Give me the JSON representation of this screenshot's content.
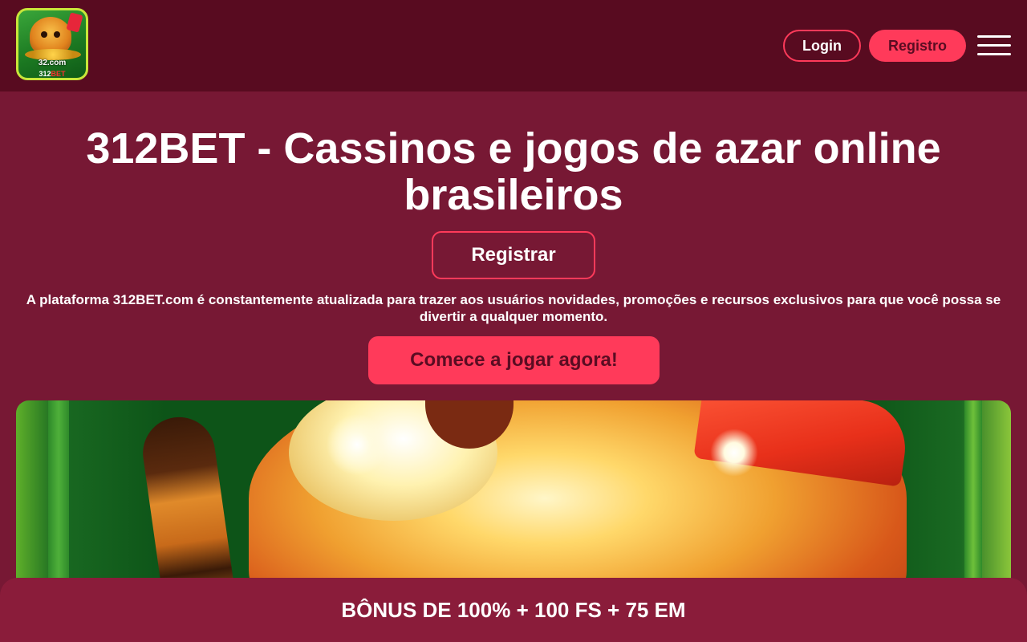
{
  "header": {
    "logo": {
      "domain_text": "32.com",
      "brand_prefix": "312",
      "brand_suffix": "BET"
    },
    "login_label": "Login",
    "register_label": "Registro"
  },
  "hero": {
    "title": "312BET - Cassinos e jogos de azar online brasileiros",
    "register_button": "Registrar",
    "description": "A plataforma 312BET.com é constantemente atualizada para trazer aos usuários novidades, promoções e recursos exclusivos para que você possa se divertir a qualquer momento.",
    "cta_button": "Comece a jogar agora!"
  },
  "bonus_bar": {
    "text": "BÔNUS DE 100% + 100 FS + 75 EM"
  },
  "colors": {
    "header_bg": "#580b20",
    "page_bg": "#771834",
    "accent": "#ff3a5a",
    "bonus_bg": "#8a1c3a"
  },
  "icons": {
    "menu": "hamburger-menu-icon"
  }
}
